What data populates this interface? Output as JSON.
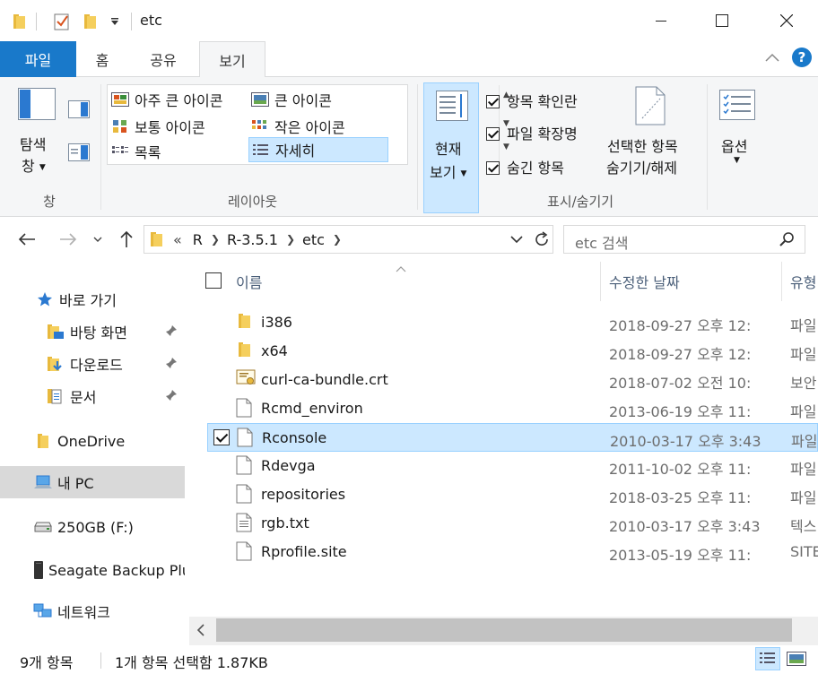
{
  "window": {
    "title": "etc"
  },
  "ribbon_tabs": [
    {
      "label": "파일"
    },
    {
      "label": "홈"
    },
    {
      "label": "공유"
    },
    {
      "label": "보기"
    }
  ],
  "ribbon": {
    "pane": {
      "line1": "탐색",
      "line2": "창",
      "group_label": "창"
    },
    "layout": {
      "items": [
        {
          "label": "아주 큰 아이콘"
        },
        {
          "label": "큰 아이콘"
        },
        {
          "label": "보통 아이콘"
        },
        {
          "label": "작은 아이콘"
        },
        {
          "label": "목록"
        },
        {
          "label": "자세히"
        }
      ],
      "group_label": "레이아웃"
    },
    "current_view": {
      "line1": "현재",
      "line2": "보기"
    },
    "show_hide": {
      "checkboxes": [
        {
          "label": "항목 확인란",
          "checked": true
        },
        {
          "label": "파일 확장명",
          "checked": true
        },
        {
          "label": "숨긴 항목",
          "checked": true
        }
      ],
      "hide_selected_line1": "선택한 항목",
      "hide_selected_line2": "숨기기/해제",
      "group_label": "표시/숨기기"
    },
    "options": {
      "label": "옵션"
    }
  },
  "address": {
    "crumbs": [
      "R",
      "R-3.5.1",
      "etc"
    ],
    "overflow": "«",
    "search_placeholder": "etc 검색"
  },
  "nav": {
    "items": [
      {
        "label": "바로 가기",
        "icon": "star-icon",
        "pinned": false
      },
      {
        "label": "바탕 화면",
        "icon": "desktop-folder-icon",
        "pinned": true
      },
      {
        "label": "다운로드",
        "icon": "downloads-folder-icon",
        "pinned": true
      },
      {
        "label": "문서",
        "icon": "documents-folder-icon",
        "pinned": true
      },
      {
        "label": "OneDrive",
        "icon": "onedrive-folder-icon",
        "pinned": false
      },
      {
        "label": "내 PC",
        "icon": "pc-icon",
        "pinned": false,
        "selected": true
      },
      {
        "label": "250GB (F:)",
        "icon": "drive-icon",
        "pinned": false
      },
      {
        "label": "Seagate Backup Plus Drive",
        "icon": "external-drive-icon",
        "pinned": false
      },
      {
        "label": "네트워크",
        "icon": "network-icon",
        "pinned": false
      }
    ]
  },
  "columns": {
    "name": "이름",
    "modified": "수정한 날짜",
    "type": "유형"
  },
  "files": [
    {
      "name": "i386",
      "modified": "2018-09-27 오후 12:",
      "type": "파일",
      "kind": "folder"
    },
    {
      "name": "x64",
      "modified": "2018-09-27 오후 12:",
      "type": "파일",
      "kind": "folder"
    },
    {
      "name": "curl-ca-bundle.crt",
      "modified": "2018-07-02 오전 10:",
      "type": "보안",
      "kind": "cert"
    },
    {
      "name": "Rcmd_environ",
      "modified": "2013-06-19 오후 11:",
      "type": "파일",
      "kind": "file"
    },
    {
      "name": "Rconsole",
      "modified": "2010-03-17 오후 3:43",
      "type": "파일",
      "kind": "file",
      "selected": true
    },
    {
      "name": "Rdevga",
      "modified": "2011-10-02 오후 11:",
      "type": "파일",
      "kind": "file"
    },
    {
      "name": "repositories",
      "modified": "2018-03-25 오후 11:",
      "type": "파일",
      "kind": "file"
    },
    {
      "name": "rgb.txt",
      "modified": "2010-03-17 오후 3:43",
      "type": "텍스",
      "kind": "text"
    },
    {
      "name": "Rprofile.site",
      "modified": "2013-05-19 오후 11:",
      "type": "SITE",
      "kind": "file"
    }
  ],
  "status": {
    "count": "9개 항목",
    "selection": "1개 항목 선택함 1.87KB"
  },
  "colors": {
    "accent": "#1979ca",
    "selection": "#cce8ff",
    "selection_border": "#99d1ff",
    "folder": "#e8b93d"
  }
}
